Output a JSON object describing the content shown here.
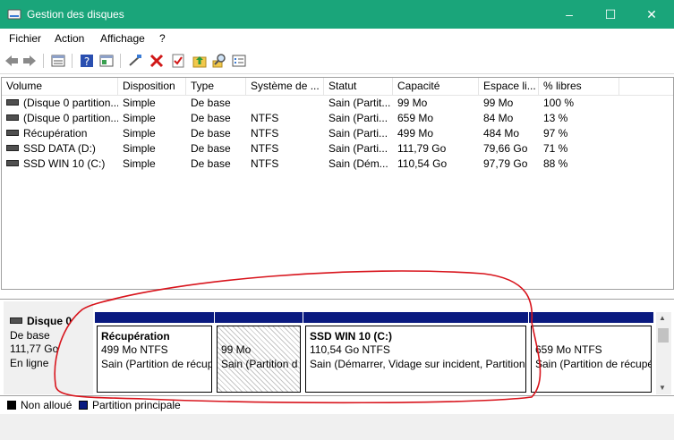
{
  "window": {
    "title": "Gestion des disques",
    "minimize": "–",
    "maximize": "☐",
    "close": "✕"
  },
  "menu": [
    "Fichier",
    "Action",
    "Affichage",
    "?"
  ],
  "toolbar": {
    "icons": [
      "back-icon",
      "forward-icon",
      "view-icon",
      "help-icon",
      "properties-icon",
      "connect-icon",
      "delete-icon",
      "check-icon",
      "folder-up-icon",
      "search-icon",
      "list-icon"
    ]
  },
  "volumes": {
    "headers": [
      "Volume",
      "Disposition",
      "Type",
      "Système de ...",
      "Statut",
      "Capacité",
      "Espace li...",
      "% libres"
    ],
    "rows": [
      [
        "(Disque 0 partition...",
        "Simple",
        "De base",
        "",
        "Sain (Partit...",
        "99 Mo",
        "99 Mo",
        "100 %"
      ],
      [
        "(Disque 0 partition...",
        "Simple",
        "De base",
        "NTFS",
        "Sain (Parti...",
        "659 Mo",
        "84 Mo",
        "13 %"
      ],
      [
        "Récupération",
        "Simple",
        "De base",
        "NTFS",
        "Sain (Parti...",
        "499 Mo",
        "484 Mo",
        "97 %"
      ],
      [
        "SSD DATA (D:)",
        "Simple",
        "De base",
        "NTFS",
        "Sain (Parti...",
        "111,79 Go",
        "79,66 Go",
        "71 %"
      ],
      [
        "SSD WIN 10 (C:)",
        "Simple",
        "De base",
        "NTFS",
        "Sain (Dém...",
        "110,54 Go",
        "97,79 Go",
        "88 %"
      ]
    ]
  },
  "disk": {
    "name": "Disque 0",
    "type": "De base",
    "size": "111,77 Go",
    "status": "En ligne",
    "partitions": [
      {
        "name": "Récupération",
        "size": "499 Mo NTFS",
        "status": "Sain (Partition de récup"
      },
      {
        "name": "",
        "size": "99 Mo",
        "status": "Sain (Partition d"
      },
      {
        "name": "SSD WIN 10  (C:)",
        "size": "110,54 Go NTFS",
        "status": "Sain (Démarrer, Vidage sur incident, Partition"
      },
      {
        "name": "",
        "size": "659 Mo NTFS",
        "status": "Sain (Partition de récupé"
      }
    ]
  },
  "legend": [
    {
      "label": "Non alloué",
      "color": "#000000"
    },
    {
      "label": "Partition principale",
      "color": "#0a1a80"
    }
  ],
  "scroll": {
    "up": "▲",
    "down": "▼"
  },
  "colors": {
    "titlebar": "#1aa57a",
    "partition_bar": "#0a1a80",
    "annotation": "#d8141c"
  }
}
